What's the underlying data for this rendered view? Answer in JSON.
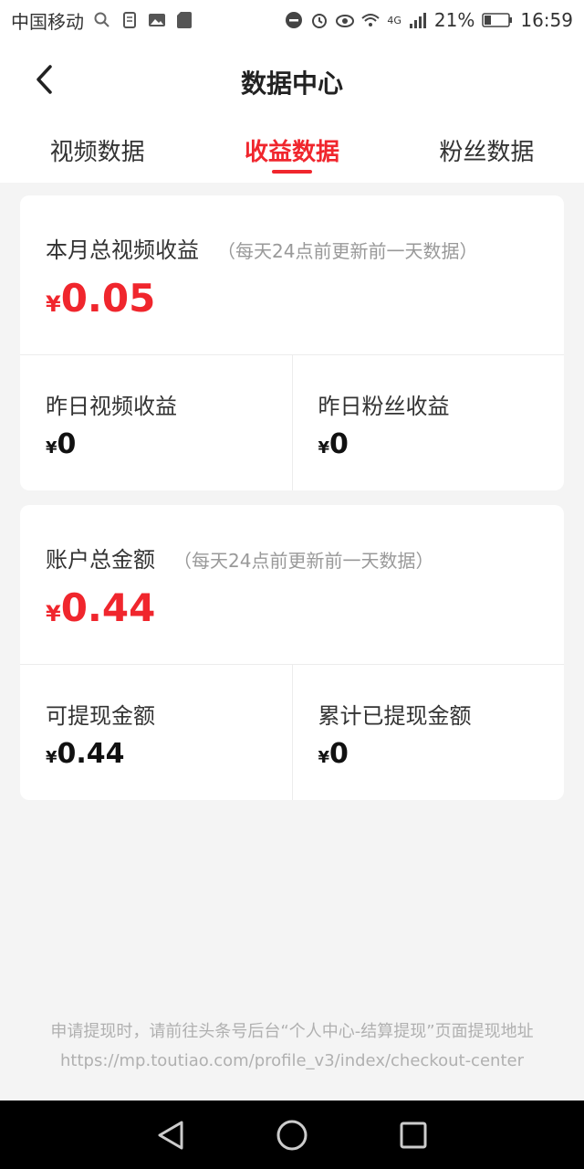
{
  "status_bar": {
    "carrier": "中国移动",
    "network": "4G",
    "battery": "21%",
    "time": "16:59",
    "icons": [
      "search-icon",
      "document-icon",
      "image-icon",
      "sd-card-icon",
      "dnd-icon",
      "alarm-icon",
      "eye-icon",
      "wifi-icon",
      "signal-icon",
      "battery-icon"
    ]
  },
  "header": {
    "title": "数据中心",
    "tabs": [
      {
        "label": "视频数据",
        "active": false
      },
      {
        "label": "收益数据",
        "active": true
      },
      {
        "label": "粉丝数据",
        "active": false
      }
    ]
  },
  "income_card": {
    "label": "本月总视频收益",
    "note": "（每天24点前更新前一天数据）",
    "currency": "¥",
    "amount": "0.05",
    "left": {
      "label": "昨日视频收益",
      "currency": "¥",
      "amount": "0"
    },
    "right": {
      "label": "昨日粉丝收益",
      "currency": "¥",
      "amount": "0"
    }
  },
  "account_card": {
    "label": "账户总金额",
    "note": "（每天24点前更新前一天数据）",
    "currency": "¥",
    "amount": "0.44",
    "left": {
      "label": "可提现金额",
      "currency": "¥",
      "amount": "0.44"
    },
    "right": {
      "label": "累计已提现金额",
      "currency": "¥",
      "amount": "0"
    }
  },
  "footer": {
    "note": "申请提现时，请前往头条号后台“个人中心-结算提现”页面提现地址 https://mp.toutiao.com/profile_v3/index/checkout-center"
  },
  "colors": {
    "accent": "#f0262d",
    "background": "#f4f4f4",
    "card": "#ffffff",
    "note_text": "#b0b0b0"
  }
}
